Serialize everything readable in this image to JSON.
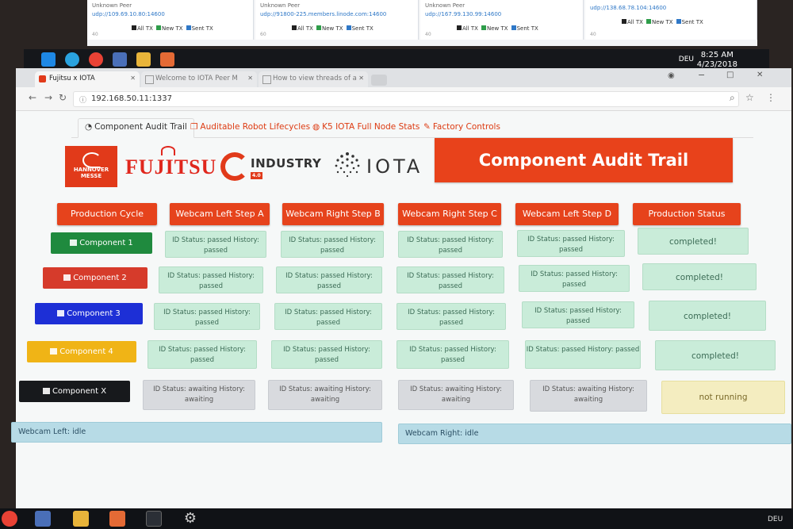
{
  "background_peers": [
    {
      "label": "Unknown Peer",
      "address": "udp://109.69.10.80:14600",
      "axis": "40"
    },
    {
      "label": "Unknown Peer",
      "address": "udp://91800-225.members.linode.com:14600",
      "axis": "60"
    },
    {
      "label": "Unknown Peer",
      "address": "udp://167.99.130.99:14600",
      "axis": "40"
    },
    {
      "label": "",
      "address": "udp://138.68.78.104:14600",
      "axis": "40"
    }
  ],
  "tx_legend": {
    "all": "All TX",
    "new": "New TX",
    "sent": "Sent TX"
  },
  "system_tray": {
    "time": "8:25 AM",
    "date": "4/23/2018",
    "language": "DEU"
  },
  "browser": {
    "tabs": [
      {
        "title": "Fujitsu x IOTA",
        "active": true
      },
      {
        "title": "Welcome to IOTA Peer M",
        "active": false
      },
      {
        "title": "How to view threads of a",
        "active": false
      }
    ],
    "url": "192.168.50.11:1337"
  },
  "nav": {
    "tabs": [
      {
        "label": "Component Audit Trail",
        "icon": "dashboard-icon"
      },
      {
        "label": "Auditable Robot Lifecycles",
        "icon": "copy-icon"
      },
      {
        "label": "K5 IOTA Full Node Stats",
        "icon": "github-icon"
      },
      {
        "label": "Factory Controls",
        "icon": "wrench-icon"
      }
    ]
  },
  "logos": {
    "hannover_line1": "HANNOVER",
    "hannover_line2": "MESSE",
    "fujitsu": "FUJITSU",
    "industry": "INDUSTRY",
    "industry_version": "4.0",
    "iota": "IOTA"
  },
  "hero": {
    "title": "Component Audit Trail"
  },
  "headers": [
    "Production Cycle",
    "Webcam Left Step A",
    "Webcam Right Step B",
    "Webcam Right Step C",
    "Webcam Left Step D",
    "Production Status"
  ],
  "components": [
    {
      "name": "Component 1",
      "color": "#1f8a3e",
      "steps": [
        "ID Status: passed History: passed",
        "ID Status: passed History: passed",
        "ID Status: passed History: passed",
        "ID Status: passed History: passed"
      ],
      "status": "completed!"
    },
    {
      "name": "Component 2",
      "color": "#d63b2b",
      "steps": [
        "ID Status: passed History: passed",
        "ID Status: passed History: passed",
        "ID Status: passed History: passed",
        "ID Status: passed History: passed"
      ],
      "status": "completed!"
    },
    {
      "name": "Component 3",
      "color": "#1d2fd6",
      "steps": [
        "ID Status: passed History: passed",
        "ID Status: passed History: passed",
        "ID Status: passed History: passed",
        "ID Status: passed History: passed"
      ],
      "status": "completed!"
    },
    {
      "name": "Component 4",
      "color": "#f0b416",
      "steps": [
        "ID Status: passed History: passed",
        "ID Status: passed History: passed",
        "ID Status: passed History: passed",
        "ID Status: passed History: passed"
      ],
      "status": "completed!"
    },
    {
      "name": "Component X",
      "color": "#17191c",
      "steps": [
        "ID Status: awaiting History: awaiting",
        "ID Status: awaiting History: awaiting",
        "ID Status: awaiting History: awaiting",
        "ID Status: awaiting History: awaiting"
      ],
      "status": "not running"
    }
  ],
  "webcams": {
    "left": "Webcam Left: idle",
    "right": "Webcam Right: idle"
  },
  "colors": {
    "accent": "#e6431c",
    "passed": "#c9ecd9",
    "awaiting": "#d8dade",
    "not_running": "#f4edc0",
    "webcam": "#b7dbe6"
  }
}
